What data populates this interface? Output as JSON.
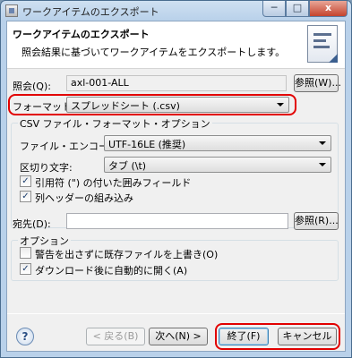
{
  "window": {
    "title": "ワークアイテムのエクスポート",
    "minimize_glyph": "─",
    "maximize_glyph": "□",
    "close_glyph": "x"
  },
  "header": {
    "title": "ワークアイテムのエクスポート",
    "description": "照会結果に基づいてワークアイテムをエクスポートします。"
  },
  "query": {
    "label": "照会(Q):",
    "value": "axl-001-ALL",
    "browse_label": "参照(W)..."
  },
  "format": {
    "label": "フォーマット(T):",
    "value": "スプレッドシート (.csv)"
  },
  "csv_options": {
    "group_title": "CSV ファイル・フォーマット・オプション",
    "encoding_label": "ファイル・エンコード:",
    "encoding_value": "UTF-16LE (推奨)",
    "delimiter_label": "区切り文字:",
    "delimiter_value": "タブ (\\t)",
    "quoted_fields_label": "引用符 (\") の付いた囲みフィールド",
    "quoted_fields_checked": true,
    "column_header_label": "列ヘッダーの組み込み",
    "column_header_checked": true
  },
  "destination": {
    "label": "宛先(D):",
    "value": "",
    "browse_label": "参照(R)..."
  },
  "options": {
    "group_title": "オプション",
    "overwrite_label": "警告を出さずに既存ファイルを上書き(O)",
    "overwrite_checked": false,
    "open_after_download_label": "ダウンロード後に自動的に開く(A)",
    "open_after_download_checked": true
  },
  "footer": {
    "help_glyph": "?",
    "back_label": "< 戻る(B)",
    "next_label": "次へ(N) >",
    "finish_label": "終了(F)",
    "cancel_label": "キャンセル"
  },
  "colors": {
    "highlight": "#e20000",
    "title_bar": "#b9d1ea",
    "dialog_bg": "#f0f0f0"
  }
}
